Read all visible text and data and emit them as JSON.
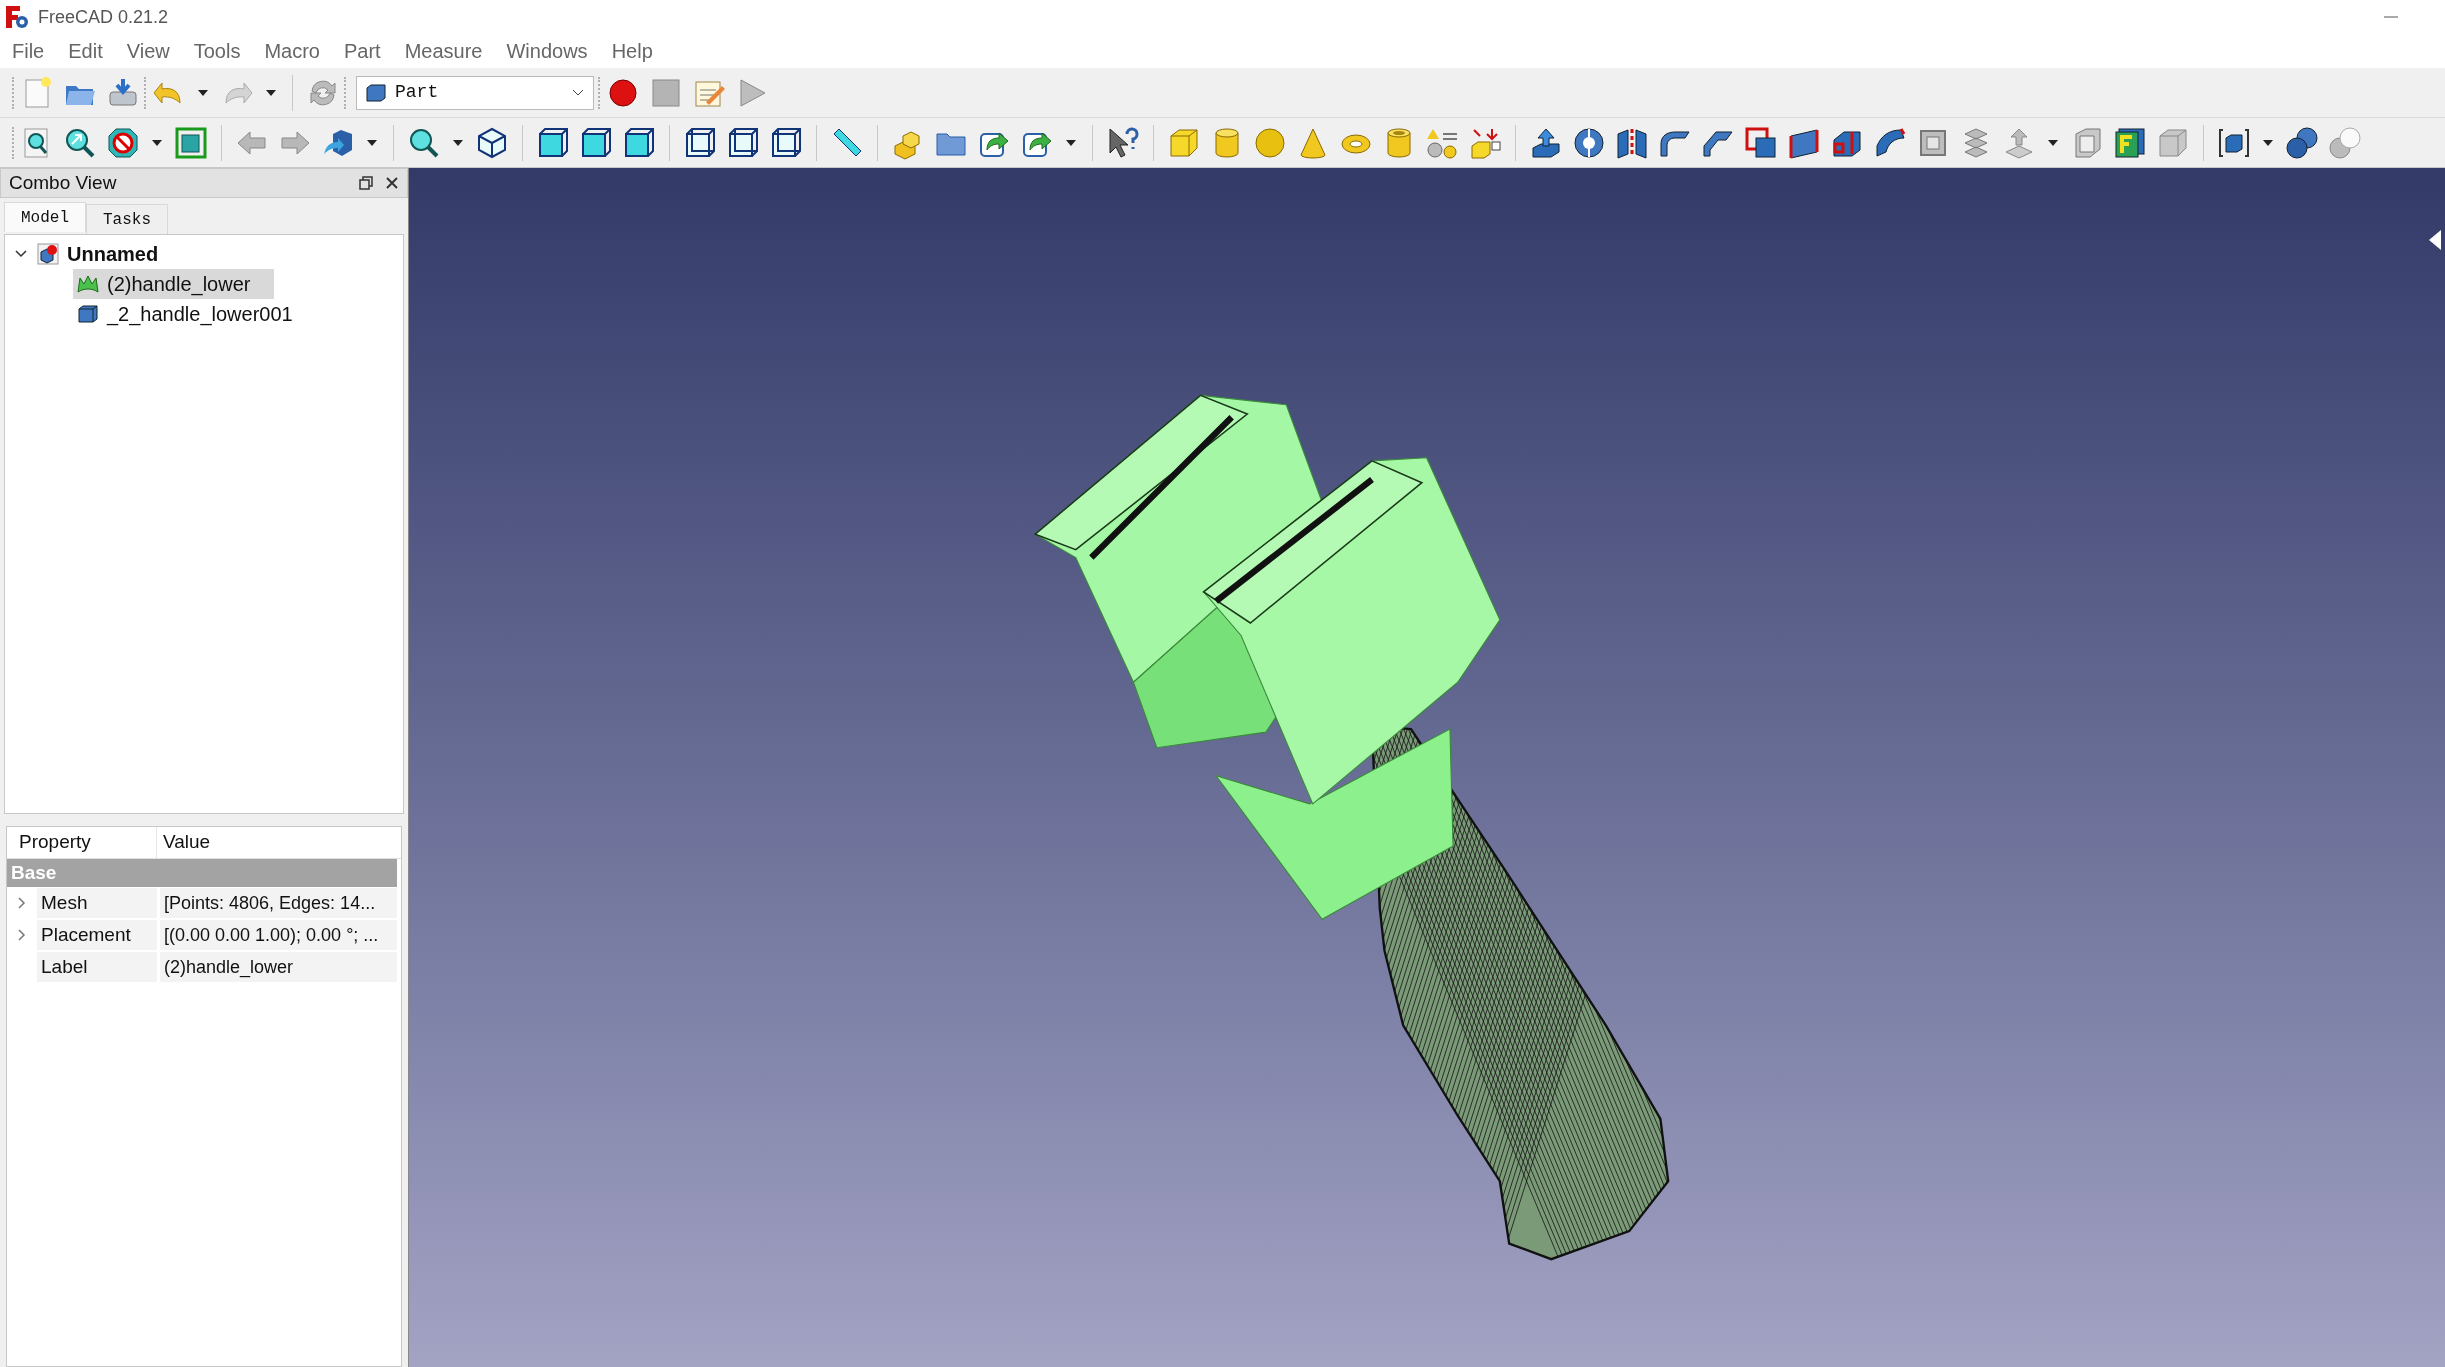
{
  "window": {
    "title": "FreeCAD 0.21.2"
  },
  "menu": [
    "File",
    "Edit",
    "View",
    "Tools",
    "Macro",
    "Part",
    "Measure",
    "Windows",
    "Help"
  ],
  "workbench": {
    "value": "Part"
  },
  "combo_view": {
    "title": "Combo View",
    "tabs": [
      {
        "label": "Model",
        "selected": true
      },
      {
        "label": "Tasks",
        "selected": false
      }
    ],
    "tree": [
      {
        "label": "Unnamed",
        "kind": "document",
        "expanded": true,
        "selected": false,
        "children": [
          {
            "label": "(2)handle_lower",
            "kind": "mesh",
            "selected": true
          },
          {
            "label": "_2_handle_lower001",
            "kind": "solid",
            "selected": false
          }
        ]
      }
    ]
  },
  "properties": {
    "columns": [
      "Property",
      "Value"
    ],
    "group": "Base",
    "rows": [
      {
        "name": "Mesh",
        "value": "[Points: 4806, Edges: 14...",
        "expandable": true
      },
      {
        "name": "Placement",
        "value": "[(0.00 0.00 1.00); 0.00 °; ...",
        "expandable": true
      },
      {
        "name": "Label",
        "value": "(2)handle_lower",
        "expandable": false
      }
    ]
  }
}
